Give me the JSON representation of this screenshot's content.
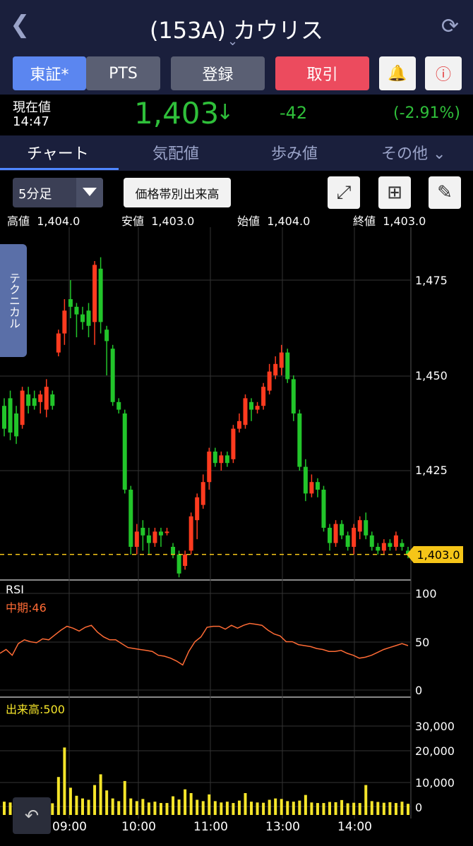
{
  "header": {
    "back_icon": "chevron-left-icon",
    "title": "(153A) カウリス",
    "reload_icon": "refresh-icon"
  },
  "toolbar": {
    "tosho": "東証*",
    "pts": "PTS",
    "register": "登録",
    "trade": "取引"
  },
  "price": {
    "label": "現在値",
    "time": "14:47",
    "value": "1,403",
    "change": "-42",
    "change_pct": "(-2.91%)"
  },
  "tabs": [
    "チャート",
    "気配値",
    "歩み値",
    "その他"
  ],
  "controls": {
    "interval": "5分足",
    "volume_profile": "価格帯別出来高"
  },
  "ohlc": {
    "high_label": "高値",
    "high": "1,404.0",
    "low_label": "安値",
    "low": "1,403.0",
    "open_label": "始値",
    "open": "1,404.0",
    "close_label": "終値",
    "close": "1,403.0"
  },
  "technical": "テクニカル",
  "current_label": "1,403.0",
  "rsi": {
    "label": "RSI",
    "mid": "中期:46"
  },
  "volume": {
    "label": "出来高:500"
  },
  "axes": {
    "price_ticks": [
      "1,475",
      "1,450",
      "1,425"
    ],
    "rsi_ticks": [
      "100",
      "50",
      "0"
    ],
    "vol_ticks": [
      "30,000",
      "20,000",
      "10,000",
      "0"
    ],
    "time_ticks": [
      "09:00",
      "10:00",
      "11:00",
      "13:00",
      "14:00"
    ]
  },
  "colors": {
    "up": "#ff3b1f",
    "down": "#22c52a",
    "rsi": "#ff6b35",
    "volume": "#f5e52a",
    "current": "#f5c518",
    "accent": "#5b86f0"
  },
  "chart_data": {
    "type": "candlestick",
    "ylim": [
      1394,
      1488
    ],
    "current": 1403,
    "candles": [
      [
        1442,
        1436,
        1444,
        1434
      ],
      [
        1444,
        1435,
        1446,
        1433
      ],
      [
        1440,
        1434,
        1442,
        1432
      ],
      [
        1437,
        1446,
        1447,
        1436
      ],
      [
        1445,
        1442,
        1447,
        1440
      ],
      [
        1444,
        1442,
        1446,
        1441
      ],
      [
        1443,
        1445,
        1446,
        1440
      ],
      [
        1441,
        1447,
        1449,
        1439
      ],
      [
        1445,
        1442,
        1446,
        1441
      ],
      [
        1456,
        1461,
        1462,
        1455
      ],
      [
        1461,
        1467,
        1470,
        1458
      ],
      [
        1470,
        1468,
        1475,
        1465
      ],
      [
        1468,
        1466,
        1469,
        1460
      ],
      [
        1466,
        1464,
        1468,
        1462
      ],
      [
        1467,
        1463,
        1469,
        1460
      ],
      [
        1464,
        1479,
        1480,
        1458
      ],
      [
        1478,
        1464,
        1481,
        1461
      ],
      [
        1462,
        1459,
        1463,
        1450
      ],
      [
        1457,
        1443,
        1458,
        1442
      ],
      [
        1443,
        1441,
        1444,
        1440
      ],
      [
        1440,
        1420,
        1441,
        1419
      ],
      [
        1420,
        1405,
        1421,
        1403
      ],
      [
        1405,
        1409,
        1411,
        1403
      ],
      [
        1410,
        1408,
        1412,
        1404
      ],
      [
        1408,
        1406,
        1410,
        1403
      ],
      [
        1406,
        1409,
        1410,
        1405
      ],
      [
        1409,
        1408,
        1410,
        1405
      ],
      [
        1409,
        1409,
        1410,
        1408
      ],
      [
        1405,
        1403,
        1406,
        1402
      ],
      [
        1403,
        1398,
        1404,
        1397
      ],
      [
        1400,
        1403,
        1404,
        1399
      ],
      [
        1404,
        1413,
        1414,
        1403
      ],
      [
        1412,
        1418,
        1419,
        1407
      ],
      [
        1416,
        1422,
        1424,
        1415
      ],
      [
        1422,
        1430,
        1431,
        1420
      ],
      [
        1430,
        1427,
        1431,
        1426
      ],
      [
        1427,
        1429,
        1430,
        1425
      ],
      [
        1429,
        1427,
        1430,
        1426
      ],
      [
        1428,
        1436,
        1437,
        1427
      ],
      [
        1436,
        1438,
        1440,
        1435
      ],
      [
        1437,
        1444,
        1445,
        1436
      ],
      [
        1443,
        1441,
        1444,
        1438
      ],
      [
        1441,
        1442,
        1443,
        1440
      ],
      [
        1442,
        1447,
        1448,
        1441
      ],
      [
        1446,
        1451,
        1453,
        1445
      ],
      [
        1450,
        1453,
        1455,
        1449
      ],
      [
        1452,
        1456,
        1458,
        1450
      ],
      [
        1456,
        1449,
        1457,
        1448
      ],
      [
        1449,
        1440,
        1450,
        1438
      ],
      [
        1440,
        1426,
        1441,
        1425
      ],
      [
        1426,
        1419,
        1428,
        1417
      ],
      [
        1419,
        1422,
        1424,
        1418
      ],
      [
        1422,
        1420,
        1423,
        1418
      ],
      [
        1420,
        1410,
        1421,
        1409
      ],
      [
        1410,
        1406,
        1411,
        1404
      ],
      [
        1406,
        1411,
        1412,
        1405
      ],
      [
        1411,
        1408,
        1412,
        1407
      ],
      [
        1408,
        1405,
        1409,
        1404
      ],
      [
        1405,
        1410,
        1411,
        1403
      ],
      [
        1409,
        1412,
        1413,
        1407
      ],
      [
        1412,
        1408,
        1414,
        1407
      ],
      [
        1408,
        1405,
        1409,
        1404
      ],
      [
        1405,
        1404,
        1406,
        1403
      ],
      [
        1404,
        1406,
        1407,
        1403
      ],
      [
        1406,
        1405,
        1407,
        1404
      ],
      [
        1405,
        1408,
        1409,
        1404
      ],
      [
        1406,
        1405,
        1407,
        1404
      ],
      [
        1404,
        1403,
        1405,
        1402
      ]
    ],
    "rsi": [
      38,
      42,
      36,
      48,
      52,
      50,
      49,
      53,
      52,
      57,
      62,
      66,
      64,
      61,
      65,
      67,
      60,
      55,
      52,
      52,
      48,
      44,
      43,
      42,
      41,
      40,
      36,
      35,
      33,
      30,
      26,
      40,
      50,
      55,
      65,
      66,
      66,
      63,
      67,
      64,
      67,
      69,
      68,
      67,
      62,
      58,
      56,
      50,
      50,
      47,
      46,
      45,
      43,
      42,
      40,
      40,
      41,
      38,
      36,
      33,
      34,
      36,
      39,
      42,
      44,
      46,
      48,
      46
    ],
    "volume": [
      1800,
      1500,
      1000,
      1500,
      1300,
      1200,
      800,
      1000,
      1200,
      11000,
      22000,
      7000,
      4000,
      3000,
      2500,
      8000,
      12000,
      6000,
      3000,
      2000,
      9500,
      3000,
      2000,
      2800,
      1500,
      1800,
      1300,
      1300,
      3800,
      2600,
      6400,
      5000,
      2500,
      2000,
      4500,
      2000,
      1500,
      1800,
      1300,
      2200,
      5000,
      1800,
      1500,
      1400,
      2500,
      3000,
      2800,
      2000,
      1800,
      2200,
      4300,
      1500,
      1300,
      1300,
      1700,
      1600,
      2400,
      1200,
      1400,
      1300,
      8000,
      2000,
      1700,
      1400,
      1600,
      1300,
      1800,
      1000
    ]
  }
}
